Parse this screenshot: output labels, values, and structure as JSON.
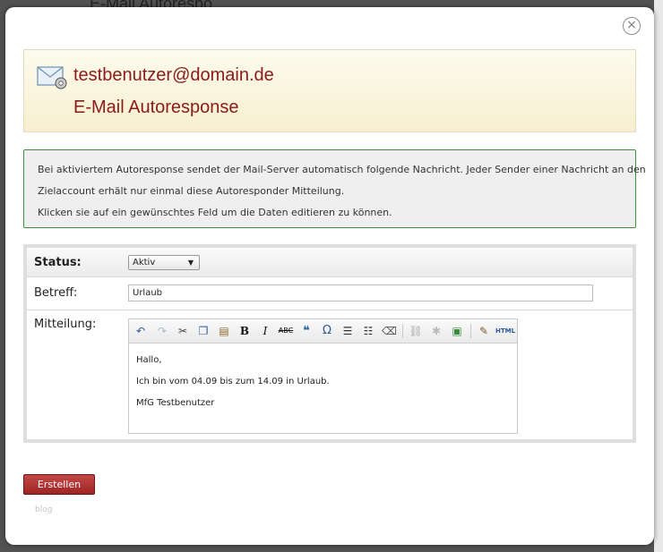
{
  "background": {
    "title": "E-Mail Autorespo"
  },
  "dialog": {
    "close_glyph": "×"
  },
  "header": {
    "email": "testbenutzer@domain.de",
    "title": "E-Mail Autoresponse",
    "icon": "mail-settings-icon"
  },
  "info": {
    "lines": [
      "Bei aktiviertem Autoresponse sendet der Mail-Server automatisch folgende Nachricht. Jeder Sender einer Nachricht an den",
      "Zielaccount erhält nur einmal diese Autoresponder Mitteilung.",
      "Klicken sie auf ein gewünschtes Feld um die Daten editieren zu können."
    ]
  },
  "form": {
    "status_label": "Status:",
    "status_value": "Aktiv",
    "subject_label": "Betreff:",
    "subject_value": "Urlaub",
    "message_label": "Mitteilung:",
    "message_lines": [
      "Hallo,",
      "Ich bin vom 04.09 bis zum 14.09 in Urlaub.",
      "MfG Testbenutzer"
    ],
    "toolbar": [
      "undo-icon",
      "redo-icon",
      "cut-icon",
      "copy-icon",
      "paste-icon",
      "bold-icon",
      "italic-icon",
      "strikethrough-icon",
      "blockquote-icon",
      "special-char-icon",
      "bullet-list-icon",
      "numbered-list-icon",
      "eraser-icon",
      "link-icon",
      "unlink-icon",
      "image-icon",
      "cleanup-icon",
      "html-icon"
    ],
    "toolbar_labels": {
      "bold": "B",
      "italic": "I",
      "strike": "ABC",
      "quote": "❝",
      "omega": "Ω",
      "html": "HTML"
    }
  },
  "actions": {
    "submit_label": "Erstellen",
    "footer_link": "blog"
  },
  "colors": {
    "title_red": "#8b1a1a",
    "info_border": "#3d8f3d",
    "button_red": "#b33a3a"
  }
}
